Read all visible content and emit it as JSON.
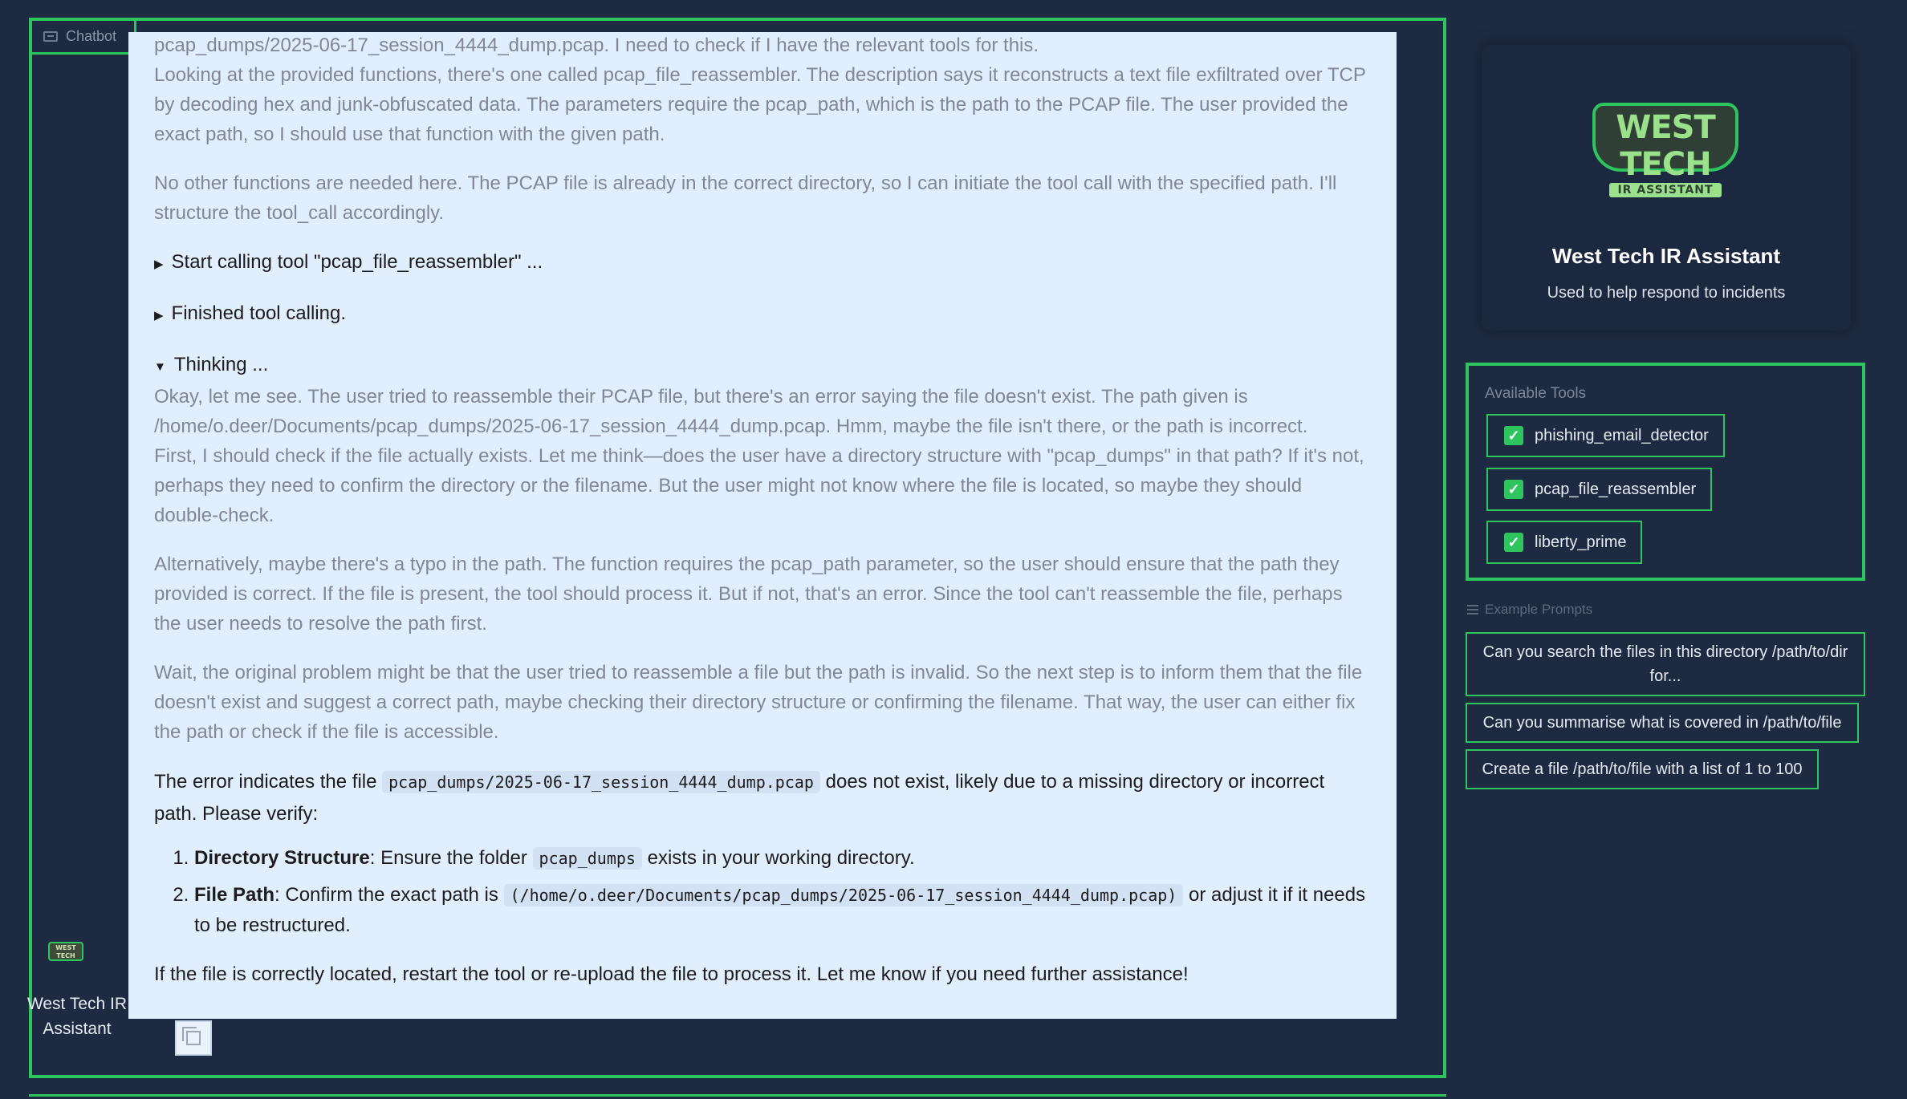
{
  "chatbot": {
    "label": "Chatbot",
    "avatar_logo_text": "WEST TECH",
    "avatar_name": "West Tech IR Assistant"
  },
  "message": {
    "p1_line1": "pcap_dumps/2025-06-17_session_4444_dump.pcap. I need to check if I have the relevant tools for this.",
    "p1_rest": "Looking at the provided functions, there's one called pcap_file_reassembler. The description says it reconstructs a text file exfiltrated over TCP by decoding hex and junk-obfuscated data. The parameters require the pcap_path, which is the path to the PCAP file. The user provided the exact path, so I should use that function with the given path.",
    "p2": "No other functions are needed here. The PCAP file is already in the correct directory, so I can initiate the tool call with the specified path. I'll structure the tool_call accordingly.",
    "detail_start_tool": "Start calling tool \"pcap_file_reassembler\" ...",
    "detail_finished": "Finished tool calling.",
    "detail_thinking": "Thinking ...",
    "t1": "Okay, let me see. The user tried to reassemble their PCAP file, but there's an error saying the file doesn't exist. The path given is /home/o.deer/Documents/pcap_dumps/2025-06-17_session_4444_dump.pcap. Hmm, maybe the file isn't there, or the path is incorrect.",
    "t2": "First, I should check if the file actually exists. Let me think—does the user have a directory structure with \"pcap_dumps\" in that path? If it's not, perhaps they need to confirm the directory or the filename. But the user might not know where the file is located, so maybe they should double-check.",
    "t3": "Alternatively, maybe there's a typo in the path. The function requires the pcap_path parameter, so the user should ensure that the path they provided is correct. If the file is present, the tool should process it. But if not, that's an error. Since the tool can't reassemble the file, perhaps the user needs to resolve the path first.",
    "t4": "Wait, the original problem might be that the user tried to reassemble a file but the path is invalid. So the next step is to inform them that the file doesn't exist and suggest a correct path, maybe checking their directory structure or confirming the filename. That way, the user can either fix the path or check if the file is accessible.",
    "answer_pre": "The error indicates the file",
    "answer_code": "pcap_dumps/2025-06-17_session_4444_dump.pcap",
    "answer_post": "does not exist, likely due to a missing directory or incorrect path. Please verify:",
    "li1_bold": "Directory Structure",
    "li1_pre": ": Ensure the folder",
    "li1_code": "pcap_dumps",
    "li1_post": "exists in your working directory.",
    "li2_bold": "File Path",
    "li2_pre": ": Confirm the exact path is",
    "li2_code": "(/home/o.deer/Documents/pcap_dumps/2025-06-17_session_4444_dump.pcap)",
    "li2_post": "or adjust it if it needs to be restructured.",
    "final": "If the file is correctly located, restart the tool or re-upload the file to process it. Let me know if you need further assistance!"
  },
  "profile": {
    "logo_line1": "WEST TECH",
    "logo_line2": "IR ASSISTANT",
    "title": "West Tech IR Assistant",
    "subtitle": "Used to help respond to incidents"
  },
  "tools": {
    "label": "Available Tools",
    "items": [
      {
        "name": "phishing_email_detector"
      },
      {
        "name": "pcap_file_reassembler"
      },
      {
        "name": "liberty_prime"
      }
    ]
  },
  "examples": {
    "label": "Example Prompts",
    "items": [
      {
        "text": "Can you search the files in this directory /path/to/dir for..."
      },
      {
        "text": "Can you summarise what is covered in /path/to/file"
      },
      {
        "text": "Create a file /path/to/file with a list of 1 to 100"
      }
    ]
  },
  "colors": {
    "accent": "#2ec45e",
    "background": "#1e2a42",
    "message_bg": "#e0eefd"
  }
}
